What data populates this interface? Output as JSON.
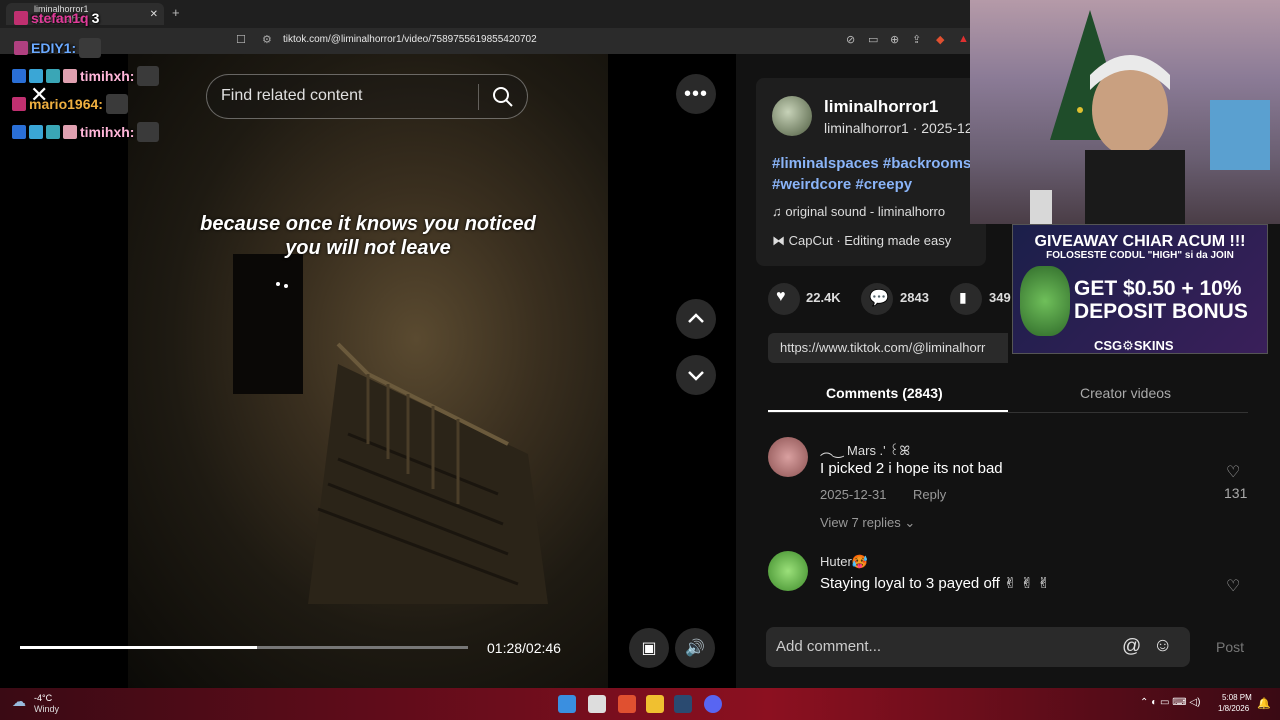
{
  "browser": {
    "tab_title": "liminalhorror1 (@liminalhorr",
    "url": "tiktok.com/@liminalhorror1/video/7589755619855420702"
  },
  "chat": [
    {
      "user": "stefan1q",
      "text": "3",
      "color": "#e23b9a"
    },
    {
      "user": "EDIY1:",
      "text": "",
      "color": "#6aa9ff"
    },
    {
      "user": "timihxh:",
      "text": "",
      "color": "#ffb6d9"
    },
    {
      "user": "mario1964:",
      "text": "",
      "color": "#f0b040"
    },
    {
      "user": "timihxh:",
      "text": "",
      "color": "#ffb6d9"
    }
  ],
  "video": {
    "search_placeholder": "Find related content",
    "caption_line1": "because once it knows you noticed",
    "caption_line2": "you will not leave",
    "time": "01:28/02:46",
    "progress": 0.53
  },
  "post": {
    "username": "liminalhorror1",
    "subline": "liminalhorror1 · 2025-12",
    "hashtags": "#liminalspaces #backrooms #weirdcore #creepy",
    "sound": "original sound - liminalhorro",
    "capcut": "CapCut · Editing made easy",
    "likes": "22.4K",
    "comments_count": "2843",
    "saves": "349",
    "link": "https://www.tiktok.com/@liminalhorr"
  },
  "tabs": {
    "comments": "Comments (2843)",
    "creator": "Creator videos"
  },
  "comments": [
    {
      "name": "︵‿ Mars .' ꒰ꕤ",
      "text": "I picked 2 i hope its not bad",
      "date": "2025-12-31",
      "reply": "Reply",
      "likes": "131",
      "view_replies": "View 7 replies"
    },
    {
      "name": "Huter🥵",
      "text": "Staying loyal to 3 payed off ✌ ✌ ✌",
      "date": "",
      "reply": "",
      "likes": "",
      "view_replies": ""
    }
  ],
  "comment_input": {
    "placeholder": "Add comment...",
    "post": "Post"
  },
  "ad": {
    "title": "GIVEAWAY CHIAR ACUM !!!",
    "sub": "FOLOSESTE CODUL \"HIGH\" si da JOIN",
    "line1": "GET $0.50 + 10%",
    "line2": "DEPOSIT BONUS",
    "brand": "CSG⚙SKINS"
  },
  "taskbar": {
    "weather_temp": "-4°C",
    "weather_desc": "Windy",
    "time": "5:08 PM",
    "date": "1/8/2026"
  }
}
